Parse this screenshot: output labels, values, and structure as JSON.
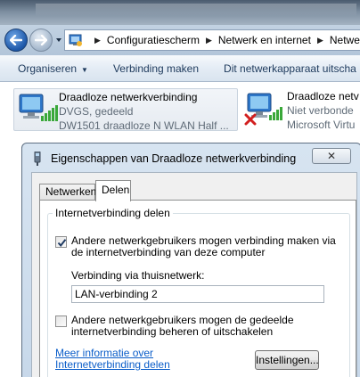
{
  "address_bar": {
    "breadcrumbs": [
      "Configuratiescherm",
      "Netwerk en internet",
      "Netwe"
    ]
  },
  "command_bar": {
    "items": [
      {
        "label": "Organiseren",
        "has_dropdown": true
      },
      {
        "label": "Verbinding maken",
        "has_dropdown": false
      },
      {
        "label": "Dit netwerkapparaat uitscha",
        "has_dropdown": false
      }
    ]
  },
  "adapters": [
    {
      "name": "Draadloze netwerkverbinding",
      "status": "DVGS, gedeeld",
      "device": "DW1501 draadloze N WLAN Half ...",
      "icon": "wireless-adapter-icon",
      "selected": true,
      "error": false
    },
    {
      "name": "Draadloze netv",
      "status": "Niet verbonde",
      "device": "Microsoft Virtu",
      "icon": "wireless-adapter-icon",
      "selected": false,
      "error": true
    }
  ],
  "dialog": {
    "title": "Eigenschappen van Draadloze netwerkverbinding",
    "close_glyph": "✕",
    "tabs": [
      {
        "label": "Netwerken",
        "active": false
      },
      {
        "label": "Delen",
        "active": true
      }
    ],
    "group_title": "Internetverbinding delen",
    "allow_sharing": {
      "checked": true,
      "label": "Andere netwerkgebruikers mogen verbinding maken via de internetverbinding van deze computer"
    },
    "home_network_label": "Verbinding via thuisnetwerk:",
    "home_network_value": "LAN-verbinding 2",
    "allow_control": {
      "checked": false,
      "label": "Andere netwerkgebruikers mogen de gedeelde internetverbinding beheren of uitschakelen"
    },
    "help_link": "Meer informatie over Internetverbinding delen",
    "settings_button": "Instellingen..."
  },
  "colors": {
    "link": "#0a5dc9",
    "glass": "#c2d2e2",
    "error_red": "#d21f1f"
  }
}
